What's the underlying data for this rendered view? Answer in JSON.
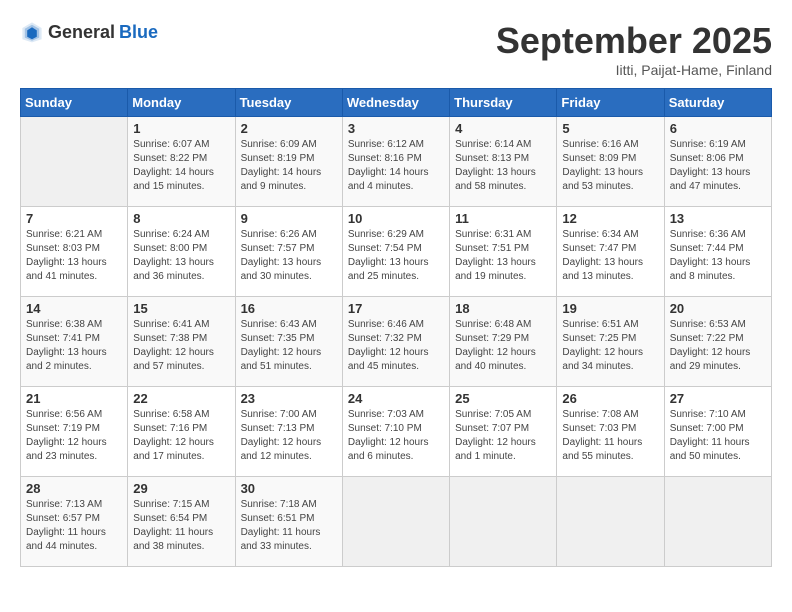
{
  "header": {
    "logo_general": "General",
    "logo_blue": "Blue",
    "month": "September 2025",
    "location": "Iitti, Paijat-Hame, Finland"
  },
  "days_of_week": [
    "Sunday",
    "Monday",
    "Tuesday",
    "Wednesday",
    "Thursday",
    "Friday",
    "Saturday"
  ],
  "weeks": [
    [
      {
        "day": "",
        "sunrise": "",
        "sunset": "",
        "daylight": ""
      },
      {
        "day": "1",
        "sunrise": "Sunrise: 6:07 AM",
        "sunset": "Sunset: 8:22 PM",
        "daylight": "Daylight: 14 hours and 15 minutes."
      },
      {
        "day": "2",
        "sunrise": "Sunrise: 6:09 AM",
        "sunset": "Sunset: 8:19 PM",
        "daylight": "Daylight: 14 hours and 9 minutes."
      },
      {
        "day": "3",
        "sunrise": "Sunrise: 6:12 AM",
        "sunset": "Sunset: 8:16 PM",
        "daylight": "Daylight: 14 hours and 4 minutes."
      },
      {
        "day": "4",
        "sunrise": "Sunrise: 6:14 AM",
        "sunset": "Sunset: 8:13 PM",
        "daylight": "Daylight: 13 hours and 58 minutes."
      },
      {
        "day": "5",
        "sunrise": "Sunrise: 6:16 AM",
        "sunset": "Sunset: 8:09 PM",
        "daylight": "Daylight: 13 hours and 53 minutes."
      },
      {
        "day": "6",
        "sunrise": "Sunrise: 6:19 AM",
        "sunset": "Sunset: 8:06 PM",
        "daylight": "Daylight: 13 hours and 47 minutes."
      }
    ],
    [
      {
        "day": "7",
        "sunrise": "Sunrise: 6:21 AM",
        "sunset": "Sunset: 8:03 PM",
        "daylight": "Daylight: 13 hours and 41 minutes."
      },
      {
        "day": "8",
        "sunrise": "Sunrise: 6:24 AM",
        "sunset": "Sunset: 8:00 PM",
        "daylight": "Daylight: 13 hours and 36 minutes."
      },
      {
        "day": "9",
        "sunrise": "Sunrise: 6:26 AM",
        "sunset": "Sunset: 7:57 PM",
        "daylight": "Daylight: 13 hours and 30 minutes."
      },
      {
        "day": "10",
        "sunrise": "Sunrise: 6:29 AM",
        "sunset": "Sunset: 7:54 PM",
        "daylight": "Daylight: 13 hours and 25 minutes."
      },
      {
        "day": "11",
        "sunrise": "Sunrise: 6:31 AM",
        "sunset": "Sunset: 7:51 PM",
        "daylight": "Daylight: 13 hours and 19 minutes."
      },
      {
        "day": "12",
        "sunrise": "Sunrise: 6:34 AM",
        "sunset": "Sunset: 7:47 PM",
        "daylight": "Daylight: 13 hours and 13 minutes."
      },
      {
        "day": "13",
        "sunrise": "Sunrise: 6:36 AM",
        "sunset": "Sunset: 7:44 PM",
        "daylight": "Daylight: 13 hours and 8 minutes."
      }
    ],
    [
      {
        "day": "14",
        "sunrise": "Sunrise: 6:38 AM",
        "sunset": "Sunset: 7:41 PM",
        "daylight": "Daylight: 13 hours and 2 minutes."
      },
      {
        "day": "15",
        "sunrise": "Sunrise: 6:41 AM",
        "sunset": "Sunset: 7:38 PM",
        "daylight": "Daylight: 12 hours and 57 minutes."
      },
      {
        "day": "16",
        "sunrise": "Sunrise: 6:43 AM",
        "sunset": "Sunset: 7:35 PM",
        "daylight": "Daylight: 12 hours and 51 minutes."
      },
      {
        "day": "17",
        "sunrise": "Sunrise: 6:46 AM",
        "sunset": "Sunset: 7:32 PM",
        "daylight": "Daylight: 12 hours and 45 minutes."
      },
      {
        "day": "18",
        "sunrise": "Sunrise: 6:48 AM",
        "sunset": "Sunset: 7:29 PM",
        "daylight": "Daylight: 12 hours and 40 minutes."
      },
      {
        "day": "19",
        "sunrise": "Sunrise: 6:51 AM",
        "sunset": "Sunset: 7:25 PM",
        "daylight": "Daylight: 12 hours and 34 minutes."
      },
      {
        "day": "20",
        "sunrise": "Sunrise: 6:53 AM",
        "sunset": "Sunset: 7:22 PM",
        "daylight": "Daylight: 12 hours and 29 minutes."
      }
    ],
    [
      {
        "day": "21",
        "sunrise": "Sunrise: 6:56 AM",
        "sunset": "Sunset: 7:19 PM",
        "daylight": "Daylight: 12 hours and 23 minutes."
      },
      {
        "day": "22",
        "sunrise": "Sunrise: 6:58 AM",
        "sunset": "Sunset: 7:16 PM",
        "daylight": "Daylight: 12 hours and 17 minutes."
      },
      {
        "day": "23",
        "sunrise": "Sunrise: 7:00 AM",
        "sunset": "Sunset: 7:13 PM",
        "daylight": "Daylight: 12 hours and 12 minutes."
      },
      {
        "day": "24",
        "sunrise": "Sunrise: 7:03 AM",
        "sunset": "Sunset: 7:10 PM",
        "daylight": "Daylight: 12 hours and 6 minutes."
      },
      {
        "day": "25",
        "sunrise": "Sunrise: 7:05 AM",
        "sunset": "Sunset: 7:07 PM",
        "daylight": "Daylight: 12 hours and 1 minute."
      },
      {
        "day": "26",
        "sunrise": "Sunrise: 7:08 AM",
        "sunset": "Sunset: 7:03 PM",
        "daylight": "Daylight: 11 hours and 55 minutes."
      },
      {
        "day": "27",
        "sunrise": "Sunrise: 7:10 AM",
        "sunset": "Sunset: 7:00 PM",
        "daylight": "Daylight: 11 hours and 50 minutes."
      }
    ],
    [
      {
        "day": "28",
        "sunrise": "Sunrise: 7:13 AM",
        "sunset": "Sunset: 6:57 PM",
        "daylight": "Daylight: 11 hours and 44 minutes."
      },
      {
        "day": "29",
        "sunrise": "Sunrise: 7:15 AM",
        "sunset": "Sunset: 6:54 PM",
        "daylight": "Daylight: 11 hours and 38 minutes."
      },
      {
        "day": "30",
        "sunrise": "Sunrise: 7:18 AM",
        "sunset": "Sunset: 6:51 PM",
        "daylight": "Daylight: 11 hours and 33 minutes."
      },
      {
        "day": "",
        "sunrise": "",
        "sunset": "",
        "daylight": ""
      },
      {
        "day": "",
        "sunrise": "",
        "sunset": "",
        "daylight": ""
      },
      {
        "day": "",
        "sunrise": "",
        "sunset": "",
        "daylight": ""
      },
      {
        "day": "",
        "sunrise": "",
        "sunset": "",
        "daylight": ""
      }
    ]
  ]
}
